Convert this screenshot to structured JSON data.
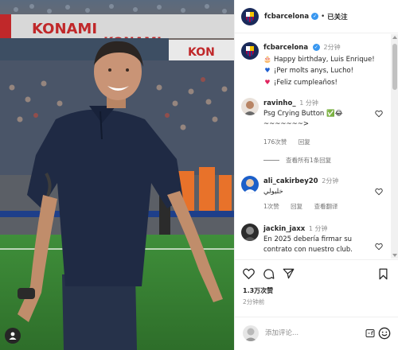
{
  "post": {
    "account": "fcbarcelona",
    "separator": "•",
    "follow_label": "已关注",
    "caption": {
      "username": "fcbarcelona",
      "time": "2分钟",
      "lines": [
        {
          "icon": "cake-icon",
          "text": "Happy birthday, Luis Enrique!"
        },
        {
          "icon": "blue-heart-icon",
          "text": "¡Per molts anys, Lucho!"
        },
        {
          "icon": "red-heart-icon",
          "text": "¡Feliz cumpleaños!"
        }
      ]
    },
    "photo": {
      "banner_text": "KONAMI",
      "banner_text_2": "KONAMI",
      "banner_text_3": "KON"
    }
  },
  "comments": [
    {
      "username": "ravinho_",
      "time": "1 分钟",
      "text": "Psg Crying Button ✅😂",
      "text2": "~~~~~~~>",
      "likes": "176次赞",
      "reply_label": "回复",
      "view_replies": "查看所有1条回复"
    },
    {
      "username": "ali_cakirbey20",
      "time": "2分钟",
      "text": "خليولي",
      "likes": "1次赞",
      "reply_label": "回复",
      "translate_label": "查看翻译"
    },
    {
      "username": "jackin_jaxx",
      "time": "1 分钟",
      "text": "En 2025 debería firmar su contrato con nuestro club."
    }
  ],
  "footer": {
    "likes": "1.3万次赞",
    "post_time": "2分钟前",
    "comment_placeholder": "添加评论..."
  },
  "colors": {
    "verified": "#3897f0",
    "brand_navy": "#1a2a5a",
    "meta_gray": "#8e8e8e"
  }
}
